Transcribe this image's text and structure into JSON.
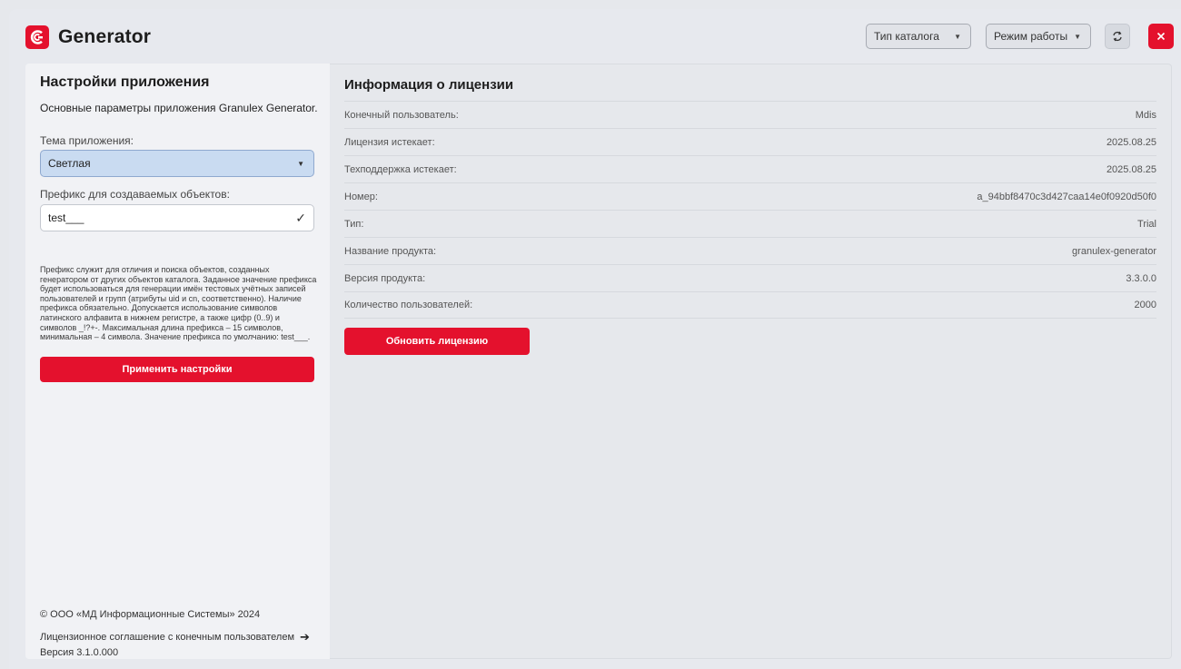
{
  "app": {
    "title": "Generator",
    "brand_color": "#e4112d"
  },
  "header": {
    "catalog_type_select": "Тип каталога",
    "mode_select": "Режим работы",
    "refresh_icon": "refresh-link-icon",
    "close_icon": "close-icon"
  },
  "settings": {
    "title": "Настройки приложения",
    "subtitle": "Основные параметры приложения Granulex Generator.",
    "theme_label": "Тема приложения:",
    "theme_value": "Светлая",
    "prefix_label": "Префикс для создаваемых объектов:",
    "prefix_value": "test___",
    "help_text": "Префикс служит для отличия и поиска объектов, созданных генератором от других объектов каталога. Заданное значение префикса будет использоваться для генерации имён тестовых учётных записей пользователей и групп (атрибуты uid и cn, соответственно). Наличие префикса обязательно. Допускается использование символов латинского алфавита в нижнем регистре, а также цифр (0..9) и символов _!?+-. Максимальная длина префикса – 15 символов, минимальная – 4 символа. Значение префикса по умолчанию: test___.",
    "apply_button": "Применить настройки"
  },
  "footer": {
    "copyright": "© ООО «МД Информационные Системы» 2024",
    "eula_link": "Лицензионное соглашение с конечным пользователем",
    "version": "Версия 3.1.0.000"
  },
  "license": {
    "title": "Информация о лицензии",
    "rows": [
      {
        "label": "Конечный пользователь:",
        "value": "Mdis"
      },
      {
        "label": "Лицензия истекает:",
        "value": "2025.08.25"
      },
      {
        "label": "Техподдержка истекает:",
        "value": "2025.08.25"
      },
      {
        "label": "Номер:",
        "value": "a_94bbf8470c3d427caa14e0f0920d50f0"
      },
      {
        "label": "Тип:",
        "value": "Trial"
      },
      {
        "label": "Название продукта:",
        "value": "granulex-generator"
      },
      {
        "label": "Версия продукта:",
        "value": "3.3.0.0"
      },
      {
        "label": "Количество пользователей:",
        "value": "2000"
      }
    ],
    "renew_button": "Обновить лицензию"
  }
}
